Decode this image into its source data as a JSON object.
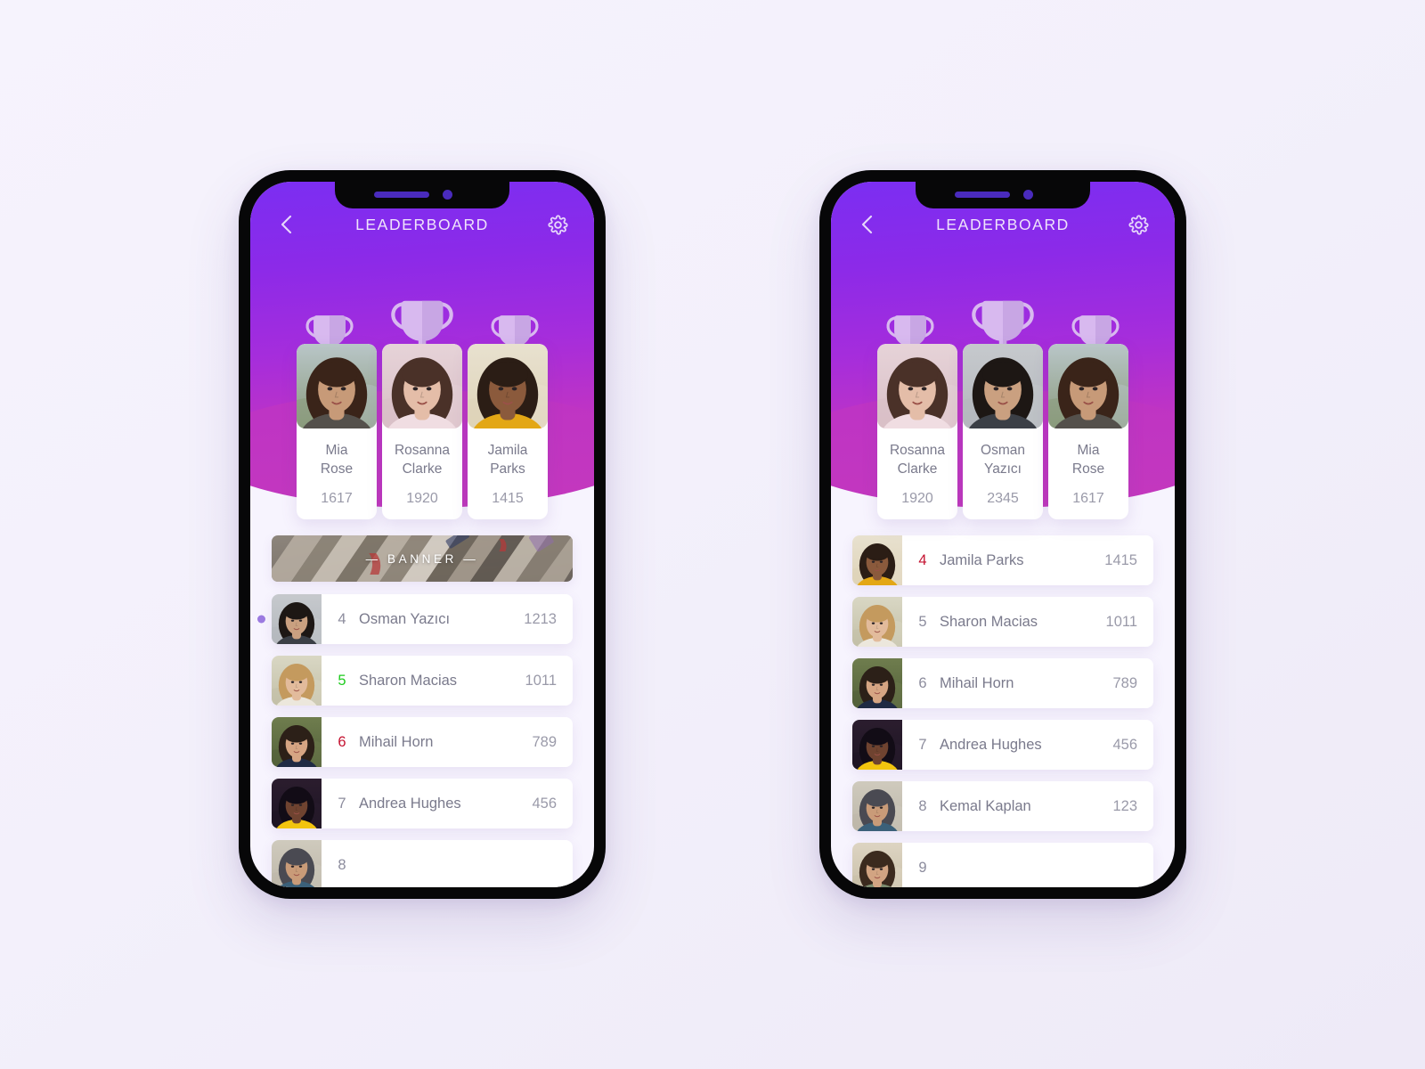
{
  "background": {
    "color": "#f5f2fd"
  },
  "theme": {
    "gradient_top": "#7b2ef2",
    "gradient_bottom": "#c438bd",
    "card_bg": "#ffffff",
    "text_primary": "#7a7a8c",
    "text_secondary": "#9a9aa9",
    "rank_green": "#1ecb1e",
    "rank_red": "#c4112f",
    "marker_dot": "#9b7ae0"
  },
  "phones": [
    {
      "id": "phone-left",
      "header": {
        "title": "LEADERBOARD",
        "back_icon": "chevron-left-icon",
        "settings_icon": "gear-icon",
        "trophy_icon": "trophy-icon",
        "trophy_count": 3
      },
      "podium": [
        {
          "name_line1": "Mia",
          "name_line2": "Rose",
          "score": "1617",
          "photo": "mia-rose"
        },
        {
          "name_line1": "Rosanna",
          "name_line2": "Clarke",
          "score": "1920",
          "photo": "rosanna-clarke"
        },
        {
          "name_line1": "Jamila",
          "name_line2": "Parks",
          "score": "1415",
          "photo": "jamila-parks"
        }
      ],
      "banner": {
        "label": "— BANNER —",
        "visible": true
      },
      "rows": [
        {
          "rank": "4",
          "name": "Osman Yazıcı",
          "score": "1213",
          "rank_color": "default",
          "marker": true,
          "photo": "osman-yazici"
        },
        {
          "rank": "5",
          "name": "Sharon Macias",
          "score": "1011",
          "rank_color": "green",
          "marker": false,
          "photo": "sharon-macias"
        },
        {
          "rank": "6",
          "name": "Mihail Horn",
          "score": "789",
          "rank_color": "red",
          "marker": false,
          "photo": "mihail-horn"
        },
        {
          "rank": "7",
          "name": "Andrea Hughes",
          "score": "456",
          "rank_color": "default",
          "marker": false,
          "photo": "andrea-hughes"
        },
        {
          "rank": "8",
          "name": "",
          "score": "",
          "rank_color": "default",
          "marker": false,
          "photo": "kemal-kaplan"
        }
      ]
    },
    {
      "id": "phone-right",
      "header": {
        "title": "LEADERBOARD",
        "back_icon": "chevron-left-icon",
        "settings_icon": "gear-icon",
        "trophy_icon": "trophy-icon",
        "trophy_count": 3
      },
      "podium": [
        {
          "name_line1": "Rosanna",
          "name_line2": "Clarke",
          "score": "1920",
          "photo": "rosanna-clarke"
        },
        {
          "name_line1": "Osman",
          "name_line2": "Yazıcı",
          "score": "2345",
          "photo": "osman-yazici"
        },
        {
          "name_line1": "Mia",
          "name_line2": "Rose",
          "score": "1617",
          "photo": "mia-rose"
        }
      ],
      "banner": {
        "label": "",
        "visible": false
      },
      "rows": [
        {
          "rank": "4",
          "name": "Jamila Parks",
          "score": "1415",
          "rank_color": "red",
          "marker": false,
          "photo": "jamila-parks"
        },
        {
          "rank": "5",
          "name": "Sharon Macias",
          "score": "1011",
          "rank_color": "default",
          "marker": false,
          "photo": "sharon-macias"
        },
        {
          "rank": "6",
          "name": "Mihail Horn",
          "score": "789",
          "rank_color": "default",
          "marker": false,
          "photo": "mihail-horn"
        },
        {
          "rank": "7",
          "name": "Andrea Hughes",
          "score": "456",
          "rank_color": "default",
          "marker": false,
          "photo": "andrea-hughes"
        },
        {
          "rank": "8",
          "name": "Kemal Kaplan",
          "score": "123",
          "rank_color": "default",
          "marker": false,
          "photo": "kemal-kaplan"
        },
        {
          "rank": "9",
          "name": "",
          "score": "",
          "rank_color": "default",
          "marker": false,
          "photo": "extra-person"
        }
      ]
    }
  ]
}
